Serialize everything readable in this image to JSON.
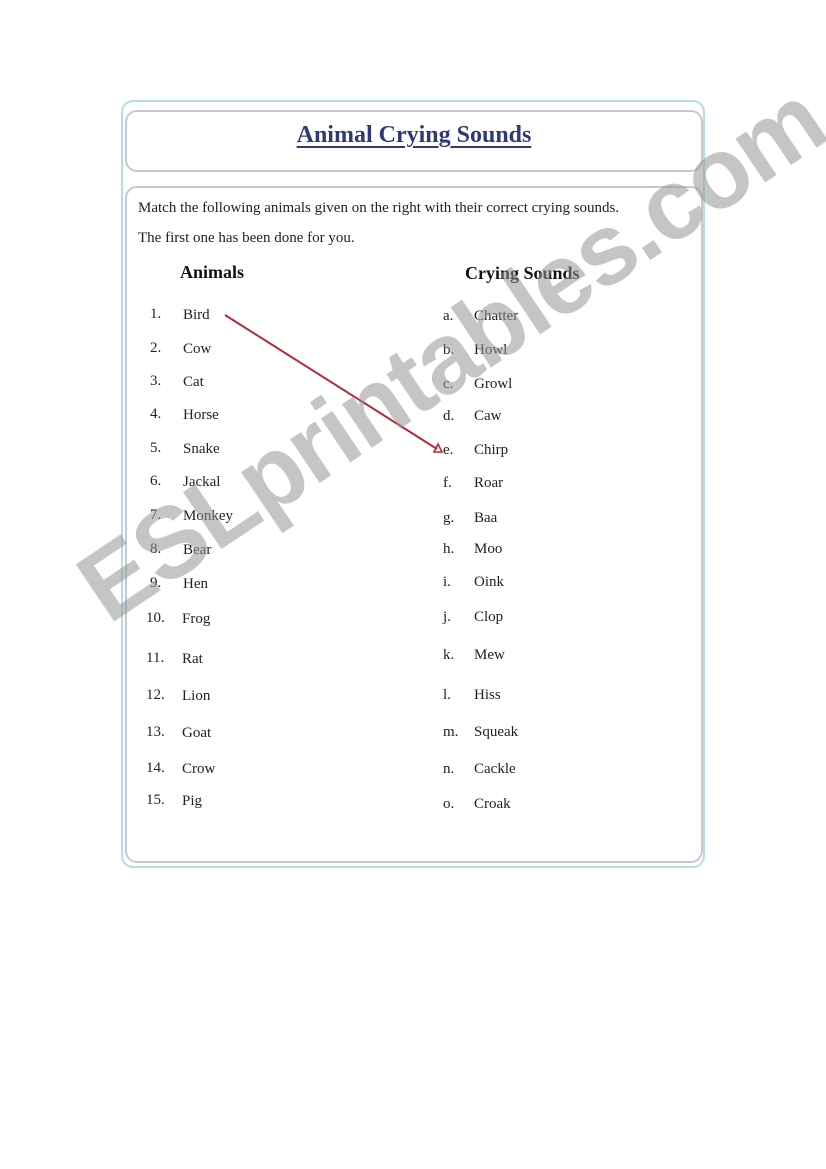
{
  "title": "Animal Crying Sounds",
  "instructions": {
    "line1": "Match the following animals given on the right with their correct crying sounds.",
    "line2": "The first one has been done for you."
  },
  "columns": {
    "animals_header": "Animals",
    "sounds_header": "Crying Sounds"
  },
  "animals": [
    {
      "num": "1.",
      "name": "Bird"
    },
    {
      "num": "2.",
      "name": "Cow"
    },
    {
      "num": "3.",
      "name": "Cat"
    },
    {
      "num": "4.",
      "name": "Horse"
    },
    {
      "num": "5.",
      "name": "Snake"
    },
    {
      "num": "6.",
      "name": "Jackal"
    },
    {
      "num": "7.",
      "name": "Monkey"
    },
    {
      "num": "8.",
      "name": "Bear"
    },
    {
      "num": "9.",
      "name": "Hen"
    },
    {
      "num": "10.",
      "name": "Frog"
    },
    {
      "num": "11.",
      "name": "Rat"
    },
    {
      "num": "12.",
      "name": "Lion"
    },
    {
      "num": "13.",
      "name": "Goat"
    },
    {
      "num": "14.",
      "name": "Crow"
    },
    {
      "num": "15.",
      "name": "Pig"
    }
  ],
  "sounds": [
    {
      "letter": "a.",
      "name": "Chatter"
    },
    {
      "letter": "b.",
      "name": "Howl"
    },
    {
      "letter": "c.",
      "name": "Growl"
    },
    {
      "letter": "d.",
      "name": "Caw"
    },
    {
      "letter": "e.",
      "name": "Chirp"
    },
    {
      "letter": "f.",
      "name": "Roar"
    },
    {
      "letter": "g.",
      "name": "Baa"
    },
    {
      "letter": "h.",
      "name": "Moo"
    },
    {
      "letter": "i.",
      "name": "Oink"
    },
    {
      "letter": "j.",
      "name": "Clop"
    },
    {
      "letter": "k.",
      "name": "Mew"
    },
    {
      "letter": "l.",
      "name": "Hiss"
    },
    {
      "letter": "m.",
      "name": "Squeak"
    },
    {
      "letter": "n.",
      "name": "Cackle"
    },
    {
      "letter": "o.",
      "name": "Croak"
    }
  ],
  "example_match": {
    "animal": "Bird",
    "sound": "Chirp",
    "line_color": "#b52a3a"
  },
  "watermark": "ESLprintables.com",
  "colors": {
    "title": "#2e3a78",
    "outer_border": "#b7dde0",
    "inner_border": "#c9c6d8"
  }
}
